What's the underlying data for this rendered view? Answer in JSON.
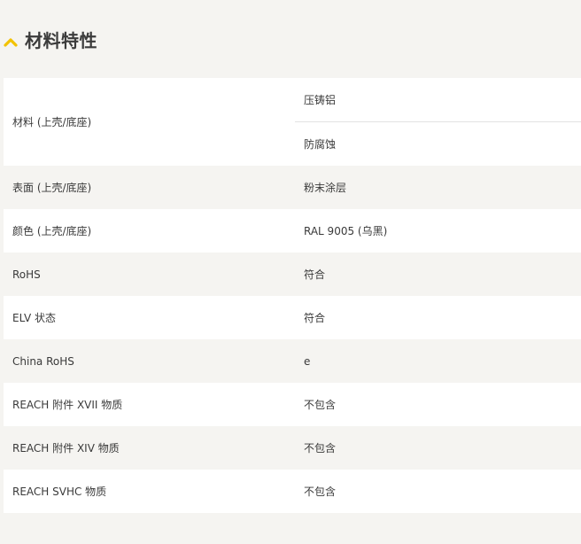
{
  "section": {
    "title": "材料特性",
    "toggle_icon": "chevron-up-icon",
    "accent_color": "#f2c200"
  },
  "properties": [
    {
      "label": "材料 (上壳/底座)",
      "values": [
        "压铸铝",
        "防腐蚀"
      ]
    },
    {
      "label": "表面 (上壳/底座)",
      "value": "粉末涂层"
    },
    {
      "label": "颜色 (上壳/底座)",
      "value": "RAL 9005 (乌黑)"
    },
    {
      "label": "RoHS",
      "value": "符合"
    },
    {
      "label": "ELV 状态",
      "value": "符合"
    },
    {
      "label": "China RoHS",
      "value": "e"
    },
    {
      "label": "REACH 附件 XVII 物质",
      "value": "不包含"
    },
    {
      "label": "REACH 附件 XIV 物质",
      "value": "不包含"
    },
    {
      "label": "REACH SVHC 物质",
      "value": "不包含"
    }
  ],
  "colors": {
    "page_background": "#f5f4f1",
    "row_white": "#ffffff",
    "row_grey": "#f5f4f1",
    "text": "#3a3a3a"
  }
}
